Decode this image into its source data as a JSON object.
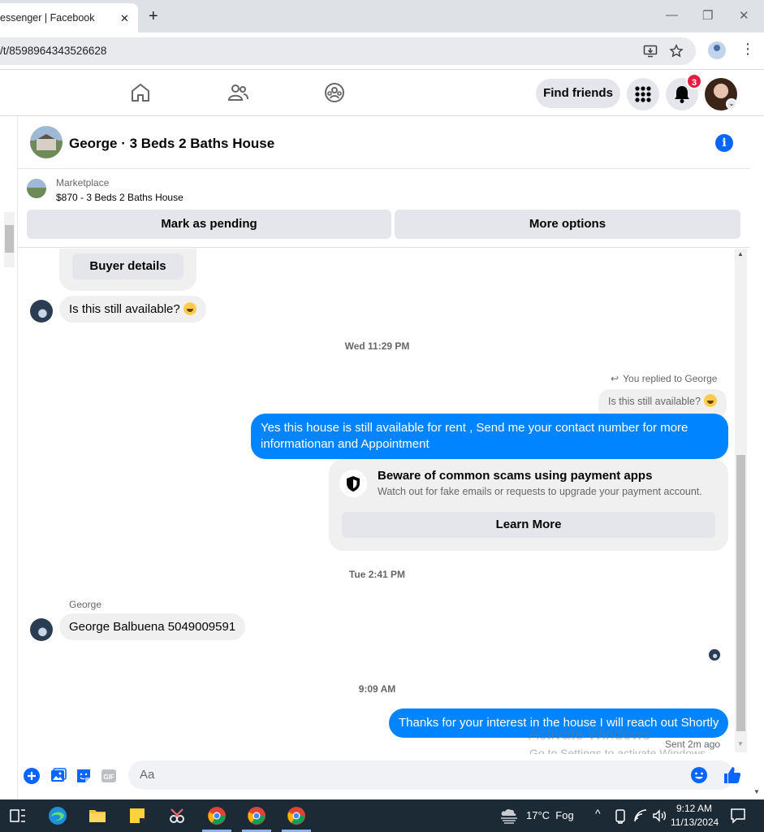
{
  "browser": {
    "tab_title": "essenger | Facebook",
    "tab_close": "✕",
    "new_tab": "+",
    "url": "/t/8598964343526628",
    "window_controls": {
      "minimize": "—",
      "restore": "❐",
      "close": "✕"
    }
  },
  "fb_nav": {
    "find_friends": "Find friends",
    "notification_count": "3"
  },
  "conversation": {
    "title": "George · 3 Beds 2 Baths House"
  },
  "marketplace": {
    "label": "Marketplace",
    "item": "$870 - 3 Beds 2 Baths House",
    "mark_pending": "Mark as pending",
    "more_options": "More options"
  },
  "messages": {
    "buyer_details": "Buyer details",
    "msg1": "Is this still available?",
    "ts1": "Wed 11:29 PM",
    "reply_label": "You replied to George",
    "reply_quote": "Is this still available?",
    "msg2": "Yes this house is still available for rent , Send me your contact number for more informationan and Appointment",
    "scam_title": "Beware of common scams using payment apps",
    "scam_sub": "Watch out for fake emails or requests to upgrade your payment account.",
    "learn_more": "Learn More",
    "ts2": "Tue 2:41 PM",
    "sender_name": "George",
    "msg3": "George Balbuena 5049009591",
    "ts3": "9:09 AM",
    "msg4": "Thanks for your interest in the house I will reach out Shortly",
    "sent_status": "Sent 2m ago"
  },
  "watermark": {
    "line1": "Activate Windows",
    "line2": "Go to Settings to activate Windows."
  },
  "composer": {
    "placeholder": "Aa"
  },
  "taskbar": {
    "weather": "17°C  Fog",
    "time": "9:12 AM",
    "date": "11/13/2024"
  },
  "colors": {
    "messenger_blue": "#0084ff",
    "fb_blue": "#0866ff",
    "badge_red": "#e41e3f",
    "taskbar": "#1c2a36"
  }
}
